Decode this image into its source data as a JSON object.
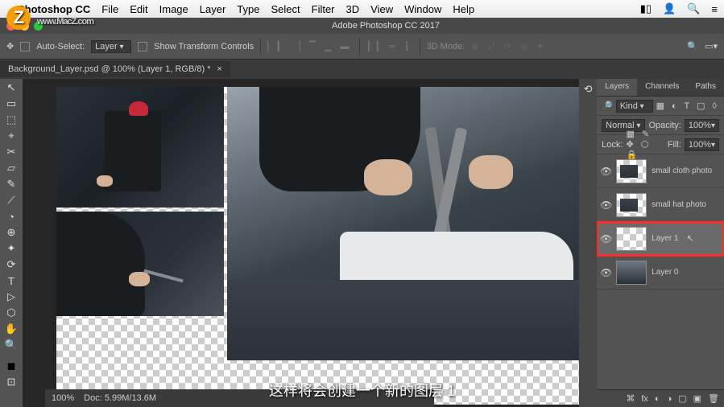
{
  "menubar": {
    "app": "Photoshop CC",
    "items": [
      "File",
      "Edit",
      "Image",
      "Layer",
      "Type",
      "Select",
      "Filter",
      "3D",
      "View",
      "Window",
      "Help"
    ]
  },
  "titlebar": {
    "title": "Adobe Photoshop CC 2017"
  },
  "options": {
    "autoSelect": "Auto-Select:",
    "target": "Layer",
    "showTransform": "Show Transform Controls",
    "mode3d": "3D Mode:"
  },
  "tab": {
    "name": "Background_Layer.psd @ 100% (Layer 1, RGB/8) *",
    "close": "×"
  },
  "tools": [
    "↖",
    "▭",
    "⬚",
    "⌖",
    "✂",
    "▱",
    "✎",
    "⟋",
    "◔",
    "⊕",
    "✦",
    "⟳",
    "T",
    "▷",
    "⬡",
    "✋",
    "🔍",
    "◼",
    "◻",
    "⊡"
  ],
  "panels": {
    "tabs": [
      "Layers",
      "Channels",
      "Paths"
    ],
    "kind": "Kind",
    "blend": "Normal",
    "opacityLabel": "Opacity:",
    "opacity": "100%",
    "lockLabel": "Lock:",
    "fillLabel": "Fill:",
    "fill": "100%",
    "layers": [
      {
        "name": "small cloth photo",
        "vis": true
      },
      {
        "name": "small hat photo",
        "vis": true
      },
      {
        "name": "Layer 1",
        "vis": true,
        "selected": true,
        "highlight": true
      },
      {
        "name": "Layer 0",
        "vis": true
      }
    ]
  },
  "status": {
    "zoom": "100%",
    "doc": "Doc: 5.99M/13.6M"
  },
  "watermark": "www.MacZ.com",
  "subtitle": "这样将会创建一个新的图层 1"
}
